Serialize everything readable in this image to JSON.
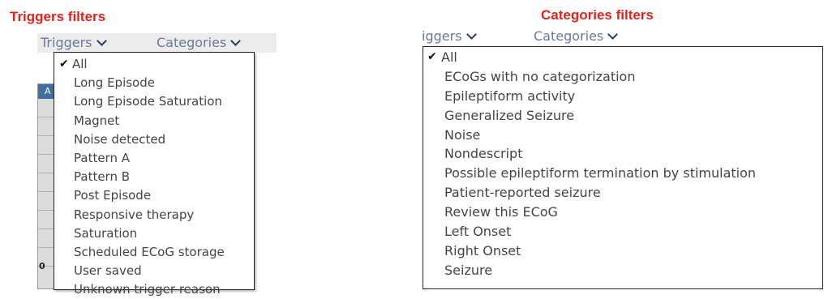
{
  "triggers_panel": {
    "caption": "Triggers filters",
    "nav": {
      "triggers_label": "Triggers",
      "categories_label": "Categories"
    },
    "table_header_letter": "A",
    "table_cell_digit": "0",
    "items": [
      "All",
      "Long Episode",
      "Long Episode Saturation",
      "Magnet",
      "Noise detected",
      "Pattern A",
      "Pattern B",
      "Post Episode",
      "Responsive therapy",
      "Saturation",
      "Scheduled ECoG storage",
      "User saved",
      "Unknown trigger reason"
    ],
    "selected_index": 0
  },
  "categories_panel": {
    "caption": "Categories filters",
    "nav": {
      "triggers_label": "iggers",
      "categories_label": "Categories"
    },
    "items": [
      "All",
      "ECoGs with no categorization",
      "Epileptiform activity",
      "Generalized Seizure",
      "Noise",
      "Nondescript",
      "Possible epileptiform termination by stimulation",
      "Patient-reported seizure",
      "Review this ECoG",
      "Left Onset",
      "Right Onset",
      "Seizure"
    ],
    "selected_index": 0
  },
  "colors": {
    "caption": "#e2231a",
    "nav_text": "#6b7896",
    "table_header": "#3f6ea0"
  }
}
